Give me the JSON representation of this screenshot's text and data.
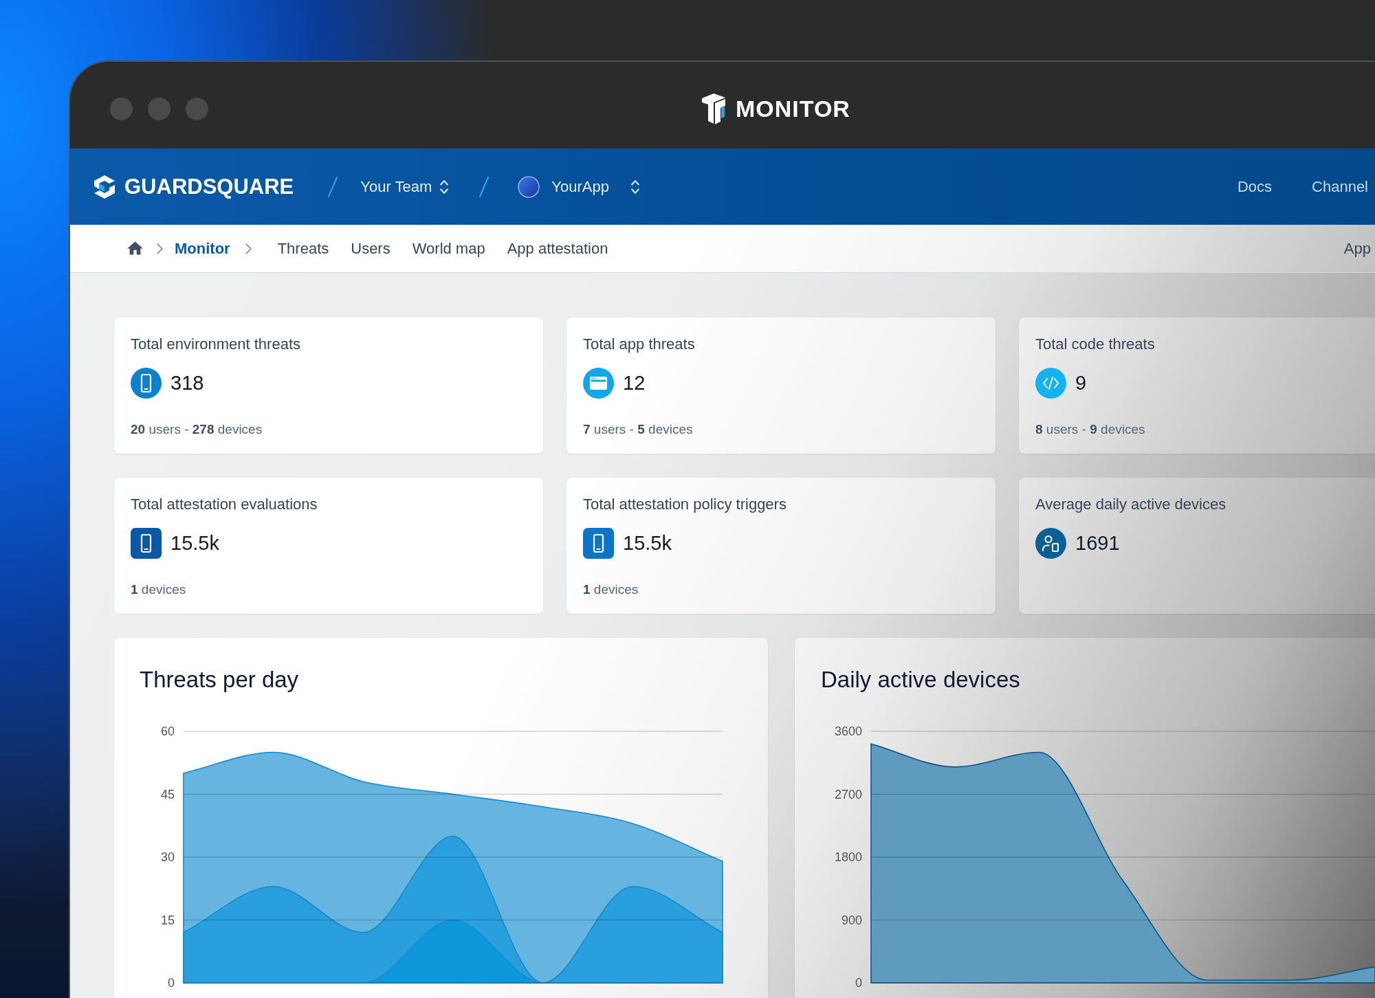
{
  "window": {
    "title": "MONITOR"
  },
  "top_nav": {
    "brand": "GUARDSQUARE",
    "team": "Your Team",
    "app": "YourApp",
    "links": [
      "Docs",
      "Channel"
    ]
  },
  "breadcrumb": [
    {
      "label": "Monitor",
      "selected": true
    }
  ],
  "tabs": [
    {
      "label": "Threats",
      "selected": false
    },
    {
      "label": "Users",
      "selected": false
    },
    {
      "label": "World map",
      "selected": false
    },
    {
      "label": "App attestation",
      "selected": false
    }
  ],
  "tabs_right": [
    "App"
  ],
  "stats": [
    {
      "title": "Total environment threats",
      "value": "318",
      "color": "#0b80cf",
      "details": "**20** users - **278** devices"
    },
    {
      "title": "Total app threats",
      "value": "12",
      "color": "#12a7e9",
      "details": "**7** users - **5** devices"
    },
    {
      "title": "Total code threats",
      "value": "9",
      "color": "#14b2f0",
      "details": "**8** users - **9** devices"
    },
    {
      "title": "Total attestation evaluations",
      "value": "15.5k",
      "color": "#0a58a6",
      "details": "**1** devices"
    },
    {
      "title": "Total attestation policy triggers",
      "value": "15.5k",
      "color": "#0e74c8",
      "details": "**1** devices"
    },
    {
      "title": "Average daily active devices",
      "value": "1691",
      "color": "#0c5f96"
    }
  ],
  "charts": [
    {
      "chart_data": {
        "type": "area",
        "title": "Threats per day",
        "ylim": [
          0,
          60
        ],
        "yticks": [
          0,
          15,
          30,
          45,
          60
        ],
        "grid": true,
        "series": [
          {
            "color": "#66b5e1",
            "values": [
              50,
              55,
              48,
              45,
              42,
              38,
              29
            ]
          },
          {
            "color": "#2a9fdd",
            "values": [
              12,
              23,
              12,
              35,
              0,
              23,
              12
            ]
          },
          {
            "color": "#0e98dc",
            "values": [
              0,
              0,
              0,
              15,
              0,
              0,
              0
            ]
          }
        ]
      }
    },
    {
      "chart_data": {
        "type": "area",
        "title": "Daily active devices",
        "ylim": [
          0,
          3600
        ],
        "yticks": [
          0,
          900,
          1800,
          2700,
          3600
        ],
        "grid": true,
        "series": [
          {
            "color": "#5e9bbf",
            "values": [
              3420,
              3090,
              3300,
              1460,
              40,
              40,
              230
            ]
          }
        ]
      }
    }
  ]
}
